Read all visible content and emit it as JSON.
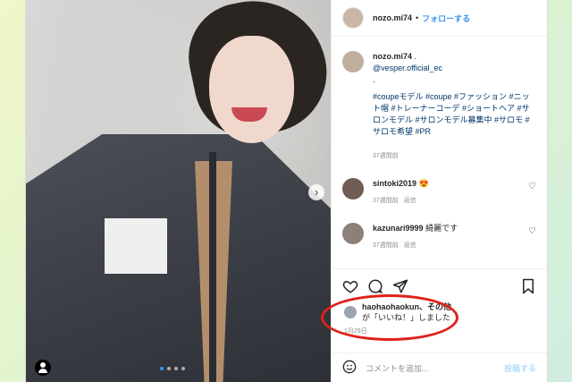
{
  "header": {
    "username": "nozo.mi74",
    "separator": "•",
    "follow_label": "フォローする"
  },
  "caption": {
    "username": "nozo.mi74",
    "line1_suffix": " .",
    "mention": "@vesper.official_ec",
    "dot": ".",
    "hashtags_text": "#coupeモデル #coupe #ファッション #ニット帽 #トレーナーコーデ #ショートヘア #サロンモデル #サロンモデル募集中 #サロモ #サロモ希望 #PR",
    "time": "37週間前"
  },
  "comments": [
    {
      "username": "sintoki2019",
      "text": "😍",
      "time": "37週間前",
      "reply": "返信"
    },
    {
      "username": "kazunari9999",
      "text": "綺麗です",
      "time": "37週間前",
      "reply": "返信"
    }
  ],
  "likes": {
    "username": "haohaohaokun",
    "suffix": "、その他",
    "line2": "が「いいね！」しました"
  },
  "post_date": "1月29日",
  "add_comment": {
    "placeholder": "コメントを追加...",
    "post_label": "投稿する"
  },
  "icons": {
    "next": "chevron-right-icon",
    "tag": "user-tag-icon",
    "like": "heart-icon",
    "comment": "comment-icon",
    "share": "share-icon",
    "save": "bookmark-icon",
    "emoji": "emoji-icon"
  },
  "colors": {
    "link": "#3897f0",
    "highlight_ring": "#e0201a"
  }
}
